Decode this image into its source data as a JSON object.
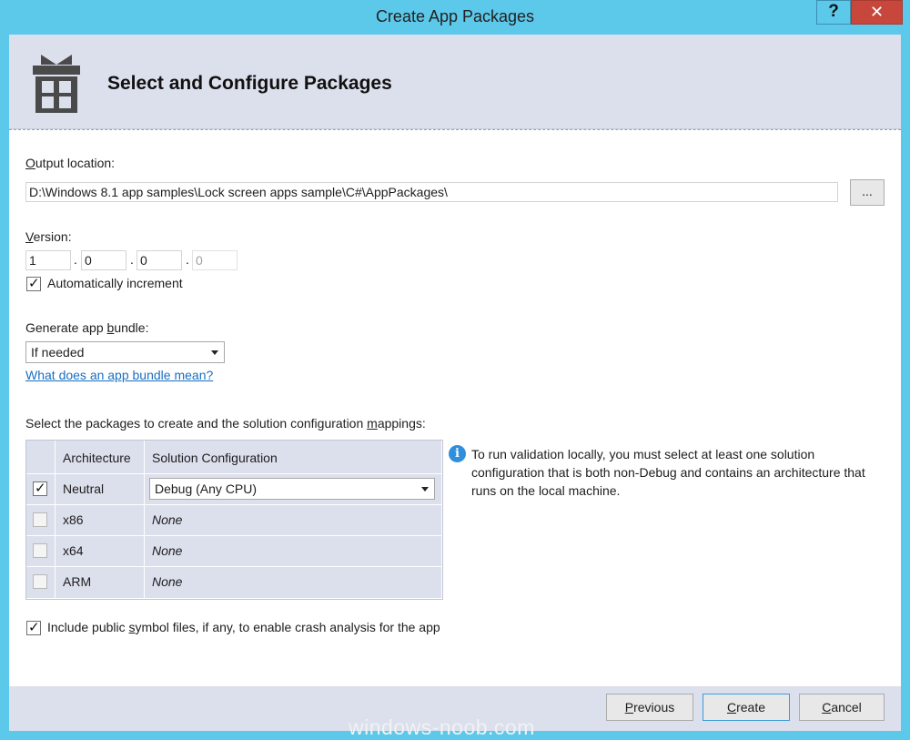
{
  "window": {
    "title": "Create App Packages",
    "help_glyph": "?",
    "close_glyph": "✕"
  },
  "header": {
    "icon": "package-icon",
    "title": "Select and Configure Packages"
  },
  "output": {
    "label_key": "O",
    "label_rest": "utput location:",
    "value": "D:\\Windows 8.1 app samples\\Lock screen apps sample\\C#\\AppPackages\\",
    "browse_label": "..."
  },
  "version": {
    "label_key": "V",
    "label_rest": "ersion:",
    "parts": [
      "1",
      "0",
      "0",
      "0"
    ],
    "separator": ".",
    "auto_increment_label": "Automatically increment",
    "auto_increment_checked": true
  },
  "bundle": {
    "label_pre": "Generate app ",
    "label_key": "b",
    "label_post": "undle:",
    "selected": "If needed",
    "help_link": "What does an app bundle mean?"
  },
  "packages": {
    "label_pre": "Select the packages to create and the solution configuration ",
    "label_key": "m",
    "label_post": "appings:",
    "columns": [
      "Architecture",
      "Solution Configuration"
    ],
    "rows": [
      {
        "checked": true,
        "arch": "Neutral",
        "config": "Debug (Any CPU)"
      },
      {
        "checked": false,
        "arch": "x86",
        "config": "None"
      },
      {
        "checked": false,
        "arch": "x64",
        "config": "None"
      },
      {
        "checked": false,
        "arch": "ARM",
        "config": "None"
      }
    ],
    "info_glyph": "i",
    "info_text": "To run validation locally, you must select at least one solution configuration that is both non-Debug and contains an architecture that runs on the local machine."
  },
  "symbols": {
    "label_pre": "Include public ",
    "label_key": "s",
    "label_post": "ymbol files, if any, to enable crash analysis for the app",
    "checked": true
  },
  "footer": {
    "previous_key": "P",
    "previous_rest": "revious",
    "create_key": "C",
    "create_rest": "reate",
    "cancel_key": "C",
    "cancel_rest": "ancel"
  },
  "watermark": "windows-noob.com",
  "colors": {
    "title_bar": "#5cc8ea",
    "close_button": "#c7473d",
    "panel": "#dcdfec",
    "link": "#1a6fc2",
    "info_icon": "#2f8fdc"
  }
}
